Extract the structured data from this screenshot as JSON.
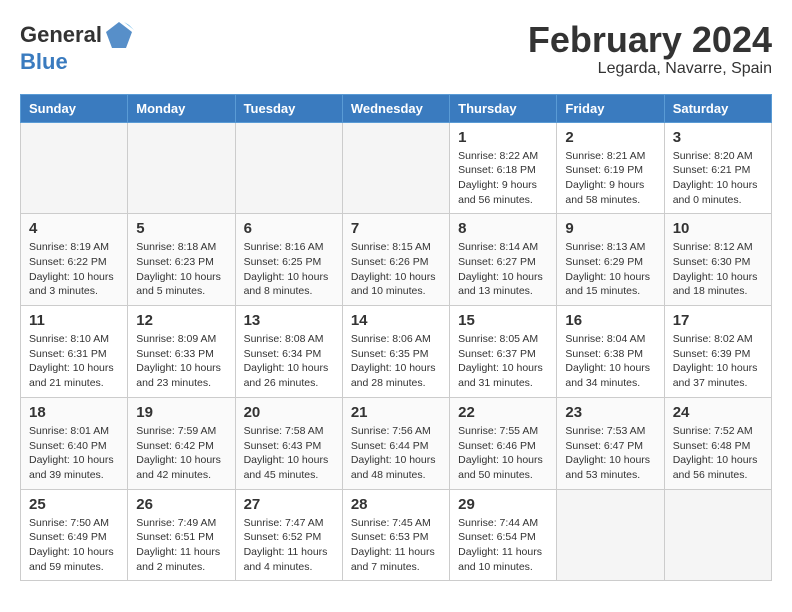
{
  "header": {
    "logo_general": "General",
    "logo_blue": "Blue",
    "month": "February 2024",
    "location": "Legarda, Navarre, Spain"
  },
  "days_of_week": [
    "Sunday",
    "Monday",
    "Tuesday",
    "Wednesday",
    "Thursday",
    "Friday",
    "Saturday"
  ],
  "weeks": [
    [
      {
        "day": "",
        "info": ""
      },
      {
        "day": "",
        "info": ""
      },
      {
        "day": "",
        "info": ""
      },
      {
        "day": "",
        "info": ""
      },
      {
        "day": "1",
        "info": "Sunrise: 8:22 AM\nSunset: 6:18 PM\nDaylight: 9 hours\nand 56 minutes."
      },
      {
        "day": "2",
        "info": "Sunrise: 8:21 AM\nSunset: 6:19 PM\nDaylight: 9 hours\nand 58 minutes."
      },
      {
        "day": "3",
        "info": "Sunrise: 8:20 AM\nSunset: 6:21 PM\nDaylight: 10 hours\nand 0 minutes."
      }
    ],
    [
      {
        "day": "4",
        "info": "Sunrise: 8:19 AM\nSunset: 6:22 PM\nDaylight: 10 hours\nand 3 minutes."
      },
      {
        "day": "5",
        "info": "Sunrise: 8:18 AM\nSunset: 6:23 PM\nDaylight: 10 hours\nand 5 minutes."
      },
      {
        "day": "6",
        "info": "Sunrise: 8:16 AM\nSunset: 6:25 PM\nDaylight: 10 hours\nand 8 minutes."
      },
      {
        "day": "7",
        "info": "Sunrise: 8:15 AM\nSunset: 6:26 PM\nDaylight: 10 hours\nand 10 minutes."
      },
      {
        "day": "8",
        "info": "Sunrise: 8:14 AM\nSunset: 6:27 PM\nDaylight: 10 hours\nand 13 minutes."
      },
      {
        "day": "9",
        "info": "Sunrise: 8:13 AM\nSunset: 6:29 PM\nDaylight: 10 hours\nand 15 minutes."
      },
      {
        "day": "10",
        "info": "Sunrise: 8:12 AM\nSunset: 6:30 PM\nDaylight: 10 hours\nand 18 minutes."
      }
    ],
    [
      {
        "day": "11",
        "info": "Sunrise: 8:10 AM\nSunset: 6:31 PM\nDaylight: 10 hours\nand 21 minutes."
      },
      {
        "day": "12",
        "info": "Sunrise: 8:09 AM\nSunset: 6:33 PM\nDaylight: 10 hours\nand 23 minutes."
      },
      {
        "day": "13",
        "info": "Sunrise: 8:08 AM\nSunset: 6:34 PM\nDaylight: 10 hours\nand 26 minutes."
      },
      {
        "day": "14",
        "info": "Sunrise: 8:06 AM\nSunset: 6:35 PM\nDaylight: 10 hours\nand 28 minutes."
      },
      {
        "day": "15",
        "info": "Sunrise: 8:05 AM\nSunset: 6:37 PM\nDaylight: 10 hours\nand 31 minutes."
      },
      {
        "day": "16",
        "info": "Sunrise: 8:04 AM\nSunset: 6:38 PM\nDaylight: 10 hours\nand 34 minutes."
      },
      {
        "day": "17",
        "info": "Sunrise: 8:02 AM\nSunset: 6:39 PM\nDaylight: 10 hours\nand 37 minutes."
      }
    ],
    [
      {
        "day": "18",
        "info": "Sunrise: 8:01 AM\nSunset: 6:40 PM\nDaylight: 10 hours\nand 39 minutes."
      },
      {
        "day": "19",
        "info": "Sunrise: 7:59 AM\nSunset: 6:42 PM\nDaylight: 10 hours\nand 42 minutes."
      },
      {
        "day": "20",
        "info": "Sunrise: 7:58 AM\nSunset: 6:43 PM\nDaylight: 10 hours\nand 45 minutes."
      },
      {
        "day": "21",
        "info": "Sunrise: 7:56 AM\nSunset: 6:44 PM\nDaylight: 10 hours\nand 48 minutes."
      },
      {
        "day": "22",
        "info": "Sunrise: 7:55 AM\nSunset: 6:46 PM\nDaylight: 10 hours\nand 50 minutes."
      },
      {
        "day": "23",
        "info": "Sunrise: 7:53 AM\nSunset: 6:47 PM\nDaylight: 10 hours\nand 53 minutes."
      },
      {
        "day": "24",
        "info": "Sunrise: 7:52 AM\nSunset: 6:48 PM\nDaylight: 10 hours\nand 56 minutes."
      }
    ],
    [
      {
        "day": "25",
        "info": "Sunrise: 7:50 AM\nSunset: 6:49 PM\nDaylight: 10 hours\nand 59 minutes."
      },
      {
        "day": "26",
        "info": "Sunrise: 7:49 AM\nSunset: 6:51 PM\nDaylight: 11 hours\nand 2 minutes."
      },
      {
        "day": "27",
        "info": "Sunrise: 7:47 AM\nSunset: 6:52 PM\nDaylight: 11 hours\nand 4 minutes."
      },
      {
        "day": "28",
        "info": "Sunrise: 7:45 AM\nSunset: 6:53 PM\nDaylight: 11 hours\nand 7 minutes."
      },
      {
        "day": "29",
        "info": "Sunrise: 7:44 AM\nSunset: 6:54 PM\nDaylight: 11 hours\nand 10 minutes."
      },
      {
        "day": "",
        "info": ""
      },
      {
        "day": "",
        "info": ""
      }
    ]
  ]
}
